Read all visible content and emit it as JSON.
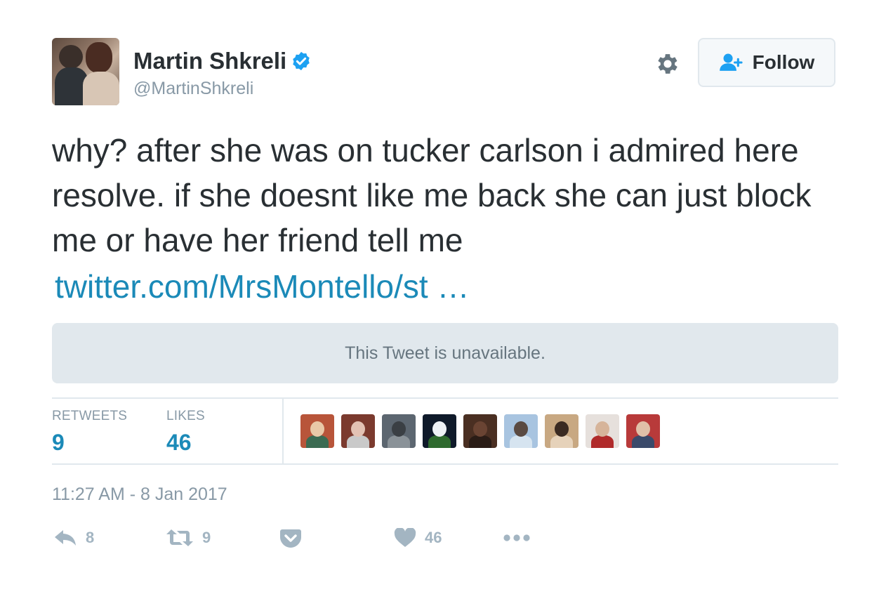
{
  "author": {
    "name": "Martin Shkreli",
    "handle": "@MartinShkreli",
    "verified": true
  },
  "actions": {
    "follow_label": "Follow"
  },
  "tweet": {
    "text": "why? after she was on tucker carlson i admired here resolve. if she doesnt like me back she can just block me or have her friend tell me",
    "link": "twitter.com/MrsMontello/st …",
    "quoted_unavailable": "This Tweet is unavailable."
  },
  "stats": {
    "retweets_label": "RETWEETS",
    "retweets_value": "9",
    "likes_label": "LIKES",
    "likes_value": "46"
  },
  "likers": [
    {
      "icon": "liker-avatar-1",
      "colors": [
        "#b8553a",
        "#e9c9a8",
        "#3b6b52"
      ]
    },
    {
      "icon": "liker-avatar-2",
      "colors": [
        "#7b3a2e",
        "#e3c2b4",
        "#c9c9c9"
      ]
    },
    {
      "icon": "liker-avatar-3",
      "colors": [
        "#5c6670",
        "#3a3f44",
        "#8a9298"
      ]
    },
    {
      "icon": "liker-avatar-4",
      "colors": [
        "#0f1a2a",
        "#eef2f6",
        "#2e6a2e"
      ]
    },
    {
      "icon": "liker-avatar-5",
      "colors": [
        "#4a2f22",
        "#6a4433",
        "#2a1c16"
      ]
    },
    {
      "icon": "liker-avatar-6",
      "colors": [
        "#a8c4e0",
        "#5a4a42",
        "#d6e4f0"
      ]
    },
    {
      "icon": "liker-avatar-7",
      "colors": [
        "#c8a882",
        "#3a2a22",
        "#e6d2ba"
      ]
    },
    {
      "icon": "liker-avatar-8",
      "colors": [
        "#e6e0dc",
        "#d6b49a",
        "#b02a2a"
      ]
    },
    {
      "icon": "liker-avatar-9",
      "colors": [
        "#b83a3a",
        "#e0c0a8",
        "#3a4a6a"
      ]
    }
  ],
  "timestamp": "11:27 AM - 8 Jan 2017",
  "footer": {
    "reply_count": "8",
    "retweet_count": "9",
    "like_count": "46"
  },
  "colors": {
    "link": "#1b8ab8",
    "verified": "#1da1f2",
    "muted": "#8899a6",
    "icon": "#a3b5c2"
  }
}
